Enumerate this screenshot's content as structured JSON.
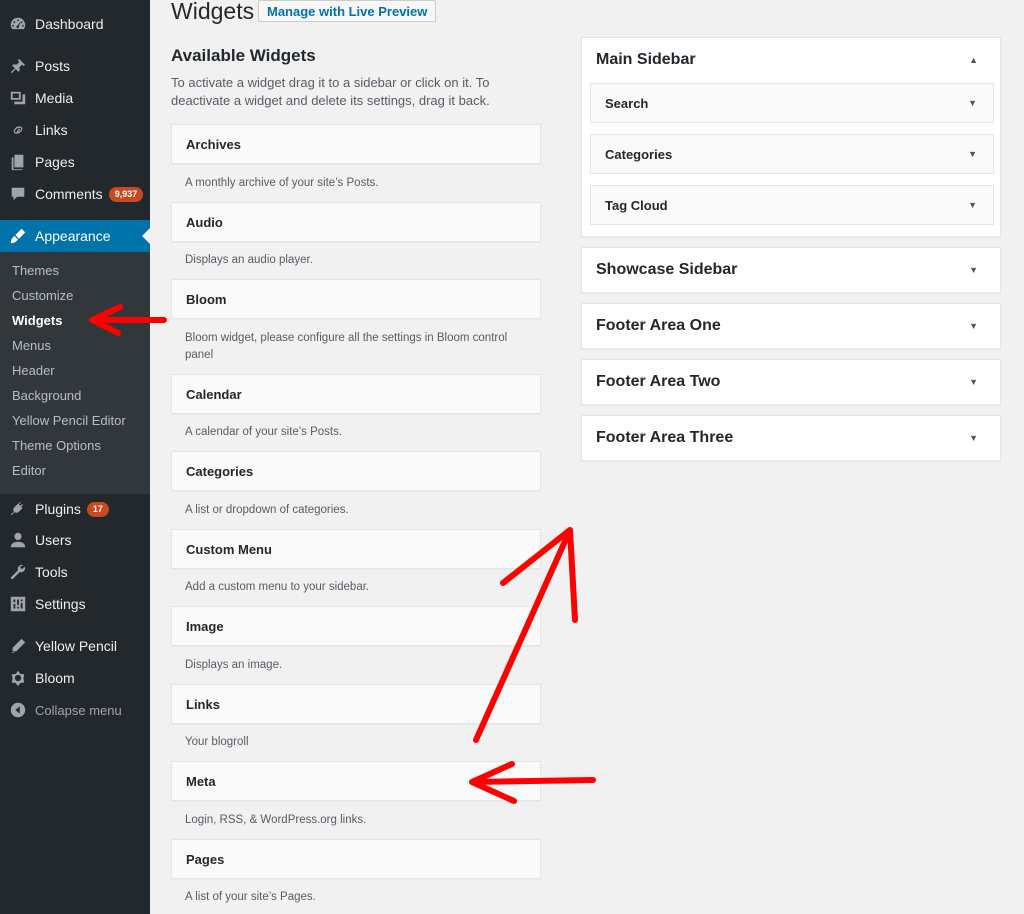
{
  "menu": {
    "items": [
      {
        "label": "Dashboard",
        "icon": "dashboard-icon"
      },
      {
        "label": "Posts",
        "icon": "pin-icon"
      },
      {
        "label": "Media",
        "icon": "media-icon"
      },
      {
        "label": "Links",
        "icon": "link-icon"
      },
      {
        "label": "Pages",
        "icon": "page-icon"
      },
      {
        "label": "Comments",
        "icon": "comment-icon",
        "badge": "9,937"
      },
      {
        "label": "Appearance",
        "icon": "brush-icon"
      },
      {
        "label": "Plugins",
        "icon": "plugin-icon",
        "badge": "17"
      },
      {
        "label": "Users",
        "icon": "user-icon"
      },
      {
        "label": "Tools",
        "icon": "wrench-icon"
      },
      {
        "label": "Settings",
        "icon": "settings-icon"
      },
      {
        "label": "Yellow Pencil",
        "icon": "pencil-icon"
      },
      {
        "label": "Bloom",
        "icon": "bloom-icon"
      },
      {
        "label": "Collapse menu",
        "icon": "collapse-icon"
      }
    ],
    "submenu": [
      "Themes",
      "Customize",
      "Widgets",
      "Menus",
      "Header",
      "Background",
      "Yellow Pencil Editor",
      "Theme Options",
      "Editor"
    ]
  },
  "header": {
    "title": "Widgets",
    "preview_button": "Manage with Live Preview"
  },
  "available": {
    "title": "Available Widgets",
    "description": "To activate a widget drag it to a sidebar or click on it. To deactivate a widget and delete its settings, drag it back.",
    "widgets": [
      {
        "name": "Archives",
        "desc": "A monthly archive of your site’s Posts."
      },
      {
        "name": "Audio",
        "desc": "Displays an audio player."
      },
      {
        "name": "Bloom",
        "desc": "Bloom widget, please configure all the settings in Bloom control panel"
      },
      {
        "name": "Calendar",
        "desc": "A calendar of your site’s Posts."
      },
      {
        "name": "Categories",
        "desc": "A list or dropdown of categories."
      },
      {
        "name": "Custom Menu",
        "desc": "Add a custom menu to your sidebar."
      },
      {
        "name": "Image",
        "desc": "Displays an image."
      },
      {
        "name": "Links",
        "desc": "Your blogroll"
      },
      {
        "name": "Meta",
        "desc": "Login, RSS, & WordPress.org links."
      },
      {
        "name": "Pages",
        "desc": "A list of your site’s Pages."
      }
    ]
  },
  "areas": {
    "main": {
      "title": "Main Sidebar",
      "widgets": [
        "Search",
        "Categories",
        "Tag Cloud"
      ]
    },
    "others": [
      "Showcase Sidebar",
      "Footer Area One",
      "Footer Area Two",
      "Footer Area Three"
    ]
  },
  "colors": {
    "menu_bg": "#23282d",
    "accent": "#0073aa",
    "badge": "#ca4a1f",
    "annotation_arrow": "#ff0000"
  }
}
